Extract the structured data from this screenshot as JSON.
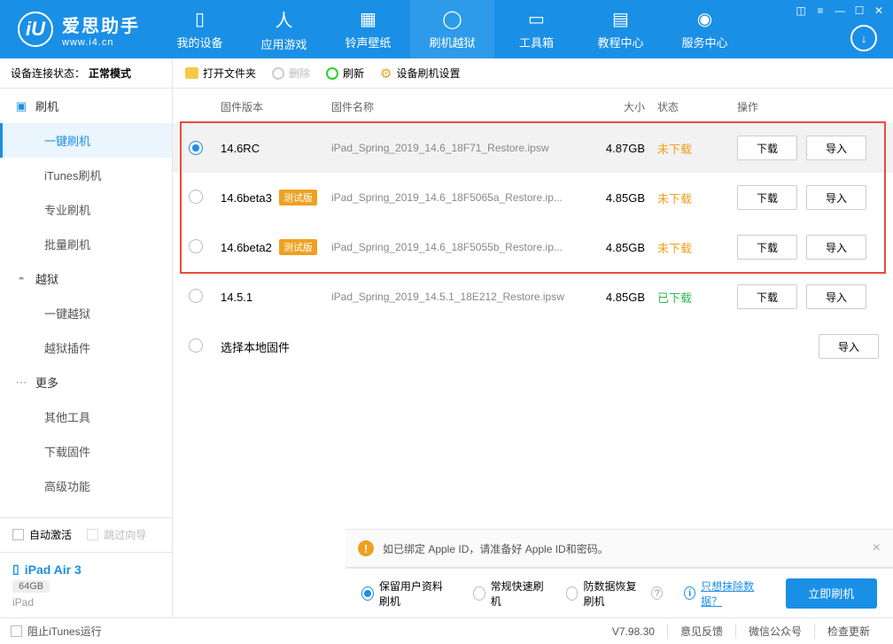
{
  "app": {
    "name": "爱思助手",
    "url": "www.i4.cn"
  },
  "nav": [
    {
      "label": "我的设备"
    },
    {
      "label": "应用游戏"
    },
    {
      "label": "铃声壁纸"
    },
    {
      "label": "刷机越狱"
    },
    {
      "label": "工具箱"
    },
    {
      "label": "教程中心"
    },
    {
      "label": "服务中心"
    }
  ],
  "status": {
    "label": "设备连接状态：",
    "value": "正常模式"
  },
  "sidebar": {
    "groups": [
      {
        "title": "刷机",
        "items": [
          "一键刷机",
          "iTunes刷机",
          "专业刷机",
          "批量刷机"
        ]
      },
      {
        "title": "越狱",
        "items": [
          "一键越狱",
          "越狱插件"
        ]
      },
      {
        "title": "更多",
        "items": [
          "其他工具",
          "下载固件",
          "高级功能"
        ]
      }
    ],
    "auto_activate": "自动激活",
    "skip_guide": "跳过向导"
  },
  "device": {
    "name": "iPad Air 3",
    "capacity": "64GB",
    "type": "iPad"
  },
  "toolbar": {
    "open": "打开文件夹",
    "delete": "删除",
    "refresh": "刷新",
    "settings": "设备刷机设置"
  },
  "table": {
    "headers": {
      "version": "固件版本",
      "name": "固件名称",
      "size": "大小",
      "status": "状态",
      "ops": "操作"
    },
    "download_btn": "下载",
    "import_btn": "导入",
    "status_no": "未下载",
    "status_yes": "已下载",
    "beta_tag": "测试版",
    "local_label": "选择本地固件",
    "rows": [
      {
        "version": "14.6RC",
        "beta": false,
        "name": "iPad_Spring_2019_14.6_18F71_Restore.ipsw",
        "size": "4.87GB",
        "downloaded": false,
        "selected": true
      },
      {
        "version": "14.6beta3",
        "beta": true,
        "name": "iPad_Spring_2019_14.6_18F5065a_Restore.ip...",
        "size": "4.85GB",
        "downloaded": false,
        "selected": false
      },
      {
        "version": "14.6beta2",
        "beta": true,
        "name": "iPad_Spring_2019_14.6_18F5055b_Restore.ip...",
        "size": "4.85GB",
        "downloaded": false,
        "selected": false
      },
      {
        "version": "14.5.1",
        "beta": false,
        "name": "iPad_Spring_2019_14.5.1_18E212_Restore.ipsw",
        "size": "4.85GB",
        "downloaded": true,
        "selected": false
      }
    ]
  },
  "notice": "如已绑定 Apple ID，请准备好 Apple ID和密码。",
  "modes": {
    "keep": "保留用户资料刷机",
    "normal": "常规快速刷机",
    "anti": "防数据恢复刷机"
  },
  "erase_link": "只想抹除数据？",
  "flash_btn": "立即刷机",
  "footer": {
    "block_itunes": "阻止iTunes运行",
    "version": "V7.98.30",
    "feedback": "意见反馈",
    "wechat": "微信公众号",
    "update": "检查更新"
  }
}
